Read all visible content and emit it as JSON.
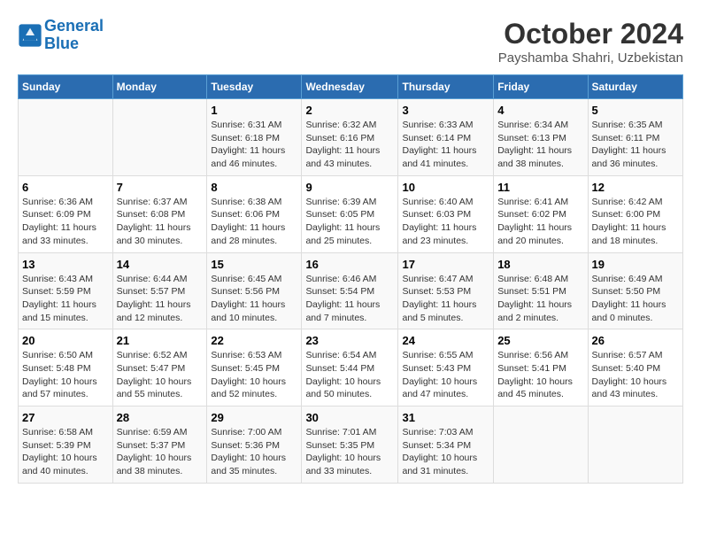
{
  "logo": {
    "line1": "General",
    "line2": "Blue"
  },
  "title": "October 2024",
  "location": "Payshamba Shahri, Uzbekistan",
  "days_of_week": [
    "Sunday",
    "Monday",
    "Tuesday",
    "Wednesday",
    "Thursday",
    "Friday",
    "Saturday"
  ],
  "weeks": [
    [
      null,
      null,
      {
        "day": "1",
        "sunrise": "6:31 AM",
        "sunset": "6:18 PM",
        "daylight": "11 hours and 46 minutes."
      },
      {
        "day": "2",
        "sunrise": "6:32 AM",
        "sunset": "6:16 PM",
        "daylight": "11 hours and 43 minutes."
      },
      {
        "day": "3",
        "sunrise": "6:33 AM",
        "sunset": "6:14 PM",
        "daylight": "11 hours and 41 minutes."
      },
      {
        "day": "4",
        "sunrise": "6:34 AM",
        "sunset": "6:13 PM",
        "daylight": "11 hours and 38 minutes."
      },
      {
        "day": "5",
        "sunrise": "6:35 AM",
        "sunset": "6:11 PM",
        "daylight": "11 hours and 36 minutes."
      }
    ],
    [
      {
        "day": "6",
        "sunrise": "6:36 AM",
        "sunset": "6:09 PM",
        "daylight": "11 hours and 33 minutes."
      },
      {
        "day": "7",
        "sunrise": "6:37 AM",
        "sunset": "6:08 PM",
        "daylight": "11 hours and 30 minutes."
      },
      {
        "day": "8",
        "sunrise": "6:38 AM",
        "sunset": "6:06 PM",
        "daylight": "11 hours and 28 minutes."
      },
      {
        "day": "9",
        "sunrise": "6:39 AM",
        "sunset": "6:05 PM",
        "daylight": "11 hours and 25 minutes."
      },
      {
        "day": "10",
        "sunrise": "6:40 AM",
        "sunset": "6:03 PM",
        "daylight": "11 hours and 23 minutes."
      },
      {
        "day": "11",
        "sunrise": "6:41 AM",
        "sunset": "6:02 PM",
        "daylight": "11 hours and 20 minutes."
      },
      {
        "day": "12",
        "sunrise": "6:42 AM",
        "sunset": "6:00 PM",
        "daylight": "11 hours and 18 minutes."
      }
    ],
    [
      {
        "day": "13",
        "sunrise": "6:43 AM",
        "sunset": "5:59 PM",
        "daylight": "11 hours and 15 minutes."
      },
      {
        "day": "14",
        "sunrise": "6:44 AM",
        "sunset": "5:57 PM",
        "daylight": "11 hours and 12 minutes."
      },
      {
        "day": "15",
        "sunrise": "6:45 AM",
        "sunset": "5:56 PM",
        "daylight": "11 hours and 10 minutes."
      },
      {
        "day": "16",
        "sunrise": "6:46 AM",
        "sunset": "5:54 PM",
        "daylight": "11 hours and 7 minutes."
      },
      {
        "day": "17",
        "sunrise": "6:47 AM",
        "sunset": "5:53 PM",
        "daylight": "11 hours and 5 minutes."
      },
      {
        "day": "18",
        "sunrise": "6:48 AM",
        "sunset": "5:51 PM",
        "daylight": "11 hours and 2 minutes."
      },
      {
        "day": "19",
        "sunrise": "6:49 AM",
        "sunset": "5:50 PM",
        "daylight": "11 hours and 0 minutes."
      }
    ],
    [
      {
        "day": "20",
        "sunrise": "6:50 AM",
        "sunset": "5:48 PM",
        "daylight": "10 hours and 57 minutes."
      },
      {
        "day": "21",
        "sunrise": "6:52 AM",
        "sunset": "5:47 PM",
        "daylight": "10 hours and 55 minutes."
      },
      {
        "day": "22",
        "sunrise": "6:53 AM",
        "sunset": "5:45 PM",
        "daylight": "10 hours and 52 minutes."
      },
      {
        "day": "23",
        "sunrise": "6:54 AM",
        "sunset": "5:44 PM",
        "daylight": "10 hours and 50 minutes."
      },
      {
        "day": "24",
        "sunrise": "6:55 AM",
        "sunset": "5:43 PM",
        "daylight": "10 hours and 47 minutes."
      },
      {
        "day": "25",
        "sunrise": "6:56 AM",
        "sunset": "5:41 PM",
        "daylight": "10 hours and 45 minutes."
      },
      {
        "day": "26",
        "sunrise": "6:57 AM",
        "sunset": "5:40 PM",
        "daylight": "10 hours and 43 minutes."
      }
    ],
    [
      {
        "day": "27",
        "sunrise": "6:58 AM",
        "sunset": "5:39 PM",
        "daylight": "10 hours and 40 minutes."
      },
      {
        "day": "28",
        "sunrise": "6:59 AM",
        "sunset": "5:37 PM",
        "daylight": "10 hours and 38 minutes."
      },
      {
        "day": "29",
        "sunrise": "7:00 AM",
        "sunset": "5:36 PM",
        "daylight": "10 hours and 35 minutes."
      },
      {
        "day": "30",
        "sunrise": "7:01 AM",
        "sunset": "5:35 PM",
        "daylight": "10 hours and 33 minutes."
      },
      {
        "day": "31",
        "sunrise": "7:03 AM",
        "sunset": "5:34 PM",
        "daylight": "10 hours and 31 minutes."
      },
      null,
      null
    ]
  ],
  "labels": {
    "sunrise": "Sunrise:",
    "sunset": "Sunset:",
    "daylight": "Daylight:"
  }
}
